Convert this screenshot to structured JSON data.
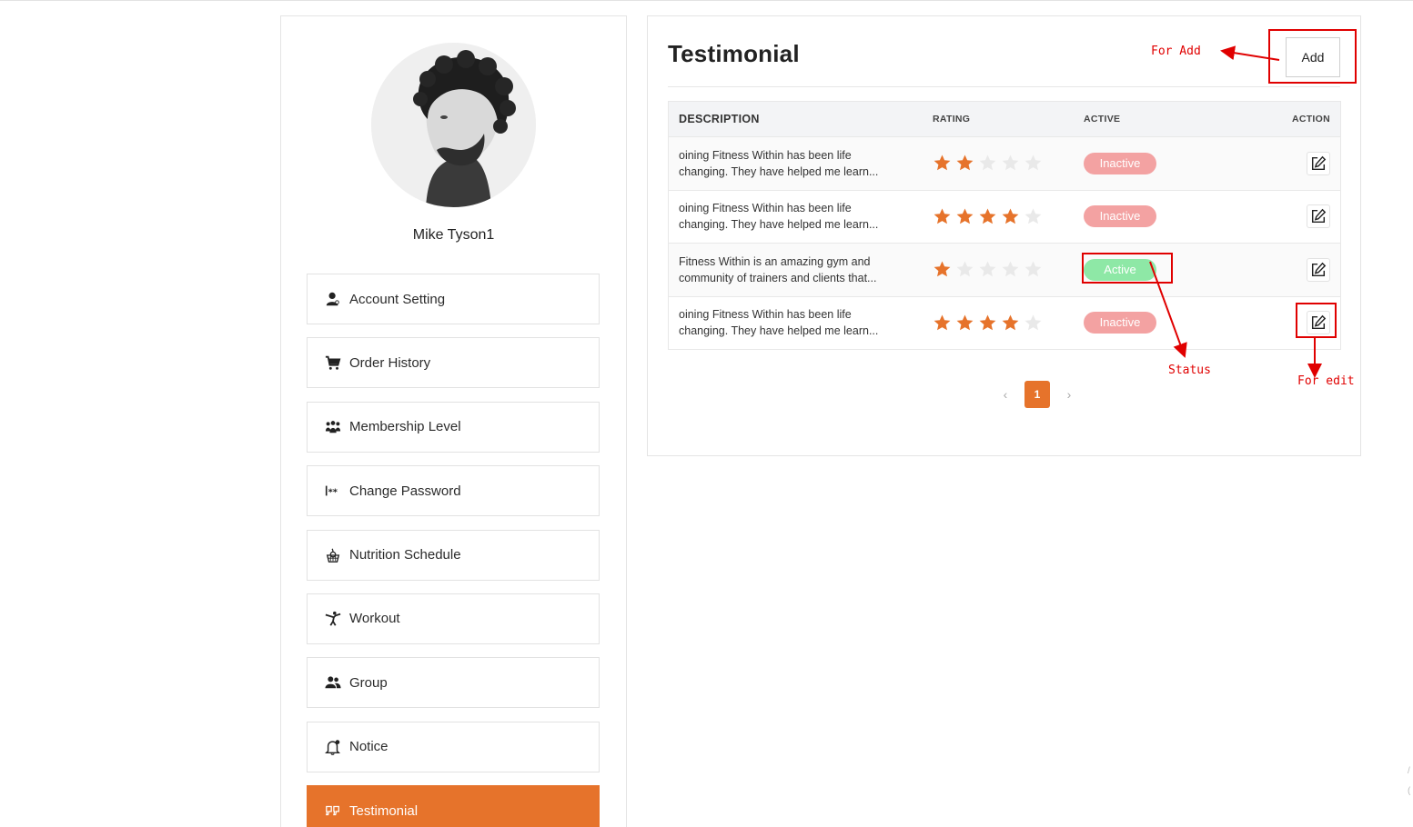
{
  "profile": {
    "name": "Mike Tyson1"
  },
  "sidebar": {
    "items": [
      {
        "label": "Account Setting",
        "icon": "user-icon",
        "active": false
      },
      {
        "label": "Order History",
        "icon": "cart-icon",
        "active": false
      },
      {
        "label": "Membership Level",
        "icon": "people-group-icon",
        "active": false
      },
      {
        "label": "Change Password",
        "icon": "password-icon",
        "active": false
      },
      {
        "label": "Nutrition Schedule",
        "icon": "apple-basket-icon",
        "active": false
      },
      {
        "label": "Workout",
        "icon": "karate-kick-icon",
        "active": false
      },
      {
        "label": "Group",
        "icon": "users-icon",
        "active": false
      },
      {
        "label": "Notice",
        "icon": "bell-icon",
        "active": false
      },
      {
        "label": "Testimonial",
        "icon": "quote-icon",
        "active": true
      }
    ]
  },
  "main": {
    "title": "Testimonial",
    "add_label": "Add",
    "table": {
      "headers": {
        "description": "DESCRIPTION",
        "rating": "RATING",
        "active": "ACTIVE",
        "action": "ACTION"
      },
      "rows": [
        {
          "description_line1": "oining Fitness Within has been life",
          "description_line2": "changing. They have helped me learn...",
          "rating": 2,
          "status": "Inactive"
        },
        {
          "description_line1": "oining Fitness Within has been life",
          "description_line2": "changing. They have helped me learn...",
          "rating": 4,
          "status": "Inactive"
        },
        {
          "description_line1": "Fitness Within is an amazing gym and",
          "description_line2": "community of trainers and clients that...",
          "rating": 1,
          "status": "Active"
        },
        {
          "description_line1": "oining Fitness Within has been life",
          "description_line2": "changing. They have helped me learn...",
          "rating": 4,
          "status": "Inactive"
        }
      ],
      "max_rating": 5
    },
    "pagination": {
      "prev": "‹",
      "current": "1",
      "next": "›"
    }
  },
  "annotations": {
    "for_add": "For Add",
    "status": "Status",
    "for_edit": "For edit"
  },
  "colors": {
    "accent": "#e6732b",
    "star_filled": "#e6732b",
    "star_empty": "#e9e9e9",
    "inactive_badge": "#f3a2a2",
    "active_badge": "#8ee8a6",
    "annotation": "#e00000"
  }
}
